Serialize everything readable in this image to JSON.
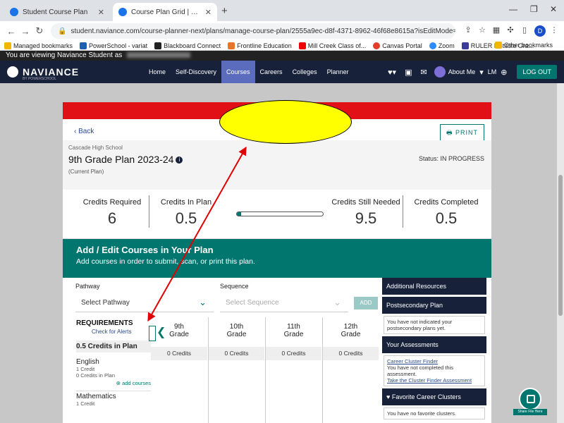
{
  "browser": {
    "tabs": [
      {
        "title": "Student Course Plan"
      },
      {
        "title": "Course Plan Grid | Manage Course..."
      }
    ],
    "url": "student.naviance.com/course-planner-next/plans/manage-course-plan/2555a9ec-d8f-4371-8962-46f68e8615a?isEditMode=true",
    "bookmarks": [
      "Managed bookmarks",
      "PowerSchool - variat",
      "Blackboard Connect",
      "Frontline Education",
      "Mill Creek Class of...",
      "Canvas Portal",
      "Zoom",
      "RULER Institute Gra..."
    ],
    "other_bookmarks": "Other bookmarks",
    "profile_initial": "D"
  },
  "viewing": {
    "text": "You are viewing Naviance Student as"
  },
  "nav": {
    "logo": "NAVIANCE",
    "logo_sub": "BY POWERSCHOOL",
    "links": [
      "Home",
      "Self-Discovery",
      "Courses",
      "Careers",
      "Colleges",
      "Planner"
    ],
    "about_me": "About Me",
    "initials": "LM",
    "logout": "LOG OUT"
  },
  "plan": {
    "back": "Back",
    "print": "PRINT",
    "school": "Cascade High School",
    "title": "9th Grade Plan 2023-24",
    "current": "(Current Plan)",
    "status": "Status: IN PROGRESS"
  },
  "credits": {
    "required_label": "Credits Required",
    "required_value": "6",
    "in_plan_label": "Credits In Plan",
    "in_plan_value": "0.5",
    "needed_label": "Credits Still Needed",
    "needed_value": "9.5",
    "completed_label": "Credits Completed",
    "completed_value": "0.5",
    "progress_fraction": 0.05
  },
  "add_section": {
    "heading": "Add / Edit Courses in Your Plan",
    "subheading": "Add courses in order to submit, scan, or print this plan."
  },
  "filters": {
    "pathway_label": "Pathway",
    "pathway_value": "Select Pathway",
    "sequence_label": "Sequence",
    "sequence_value": "Select Sequence",
    "add": "ADD"
  },
  "requirements": {
    "title": "REQUIREMENTS",
    "alerts": "Check for Alerts",
    "in_plan": "0.5 Credits in Plan",
    "subjects": [
      {
        "name": "English",
        "credit": "1 Credit",
        "in_plan": "0 Credits in Plan",
        "add": "add courses"
      },
      {
        "name": "Mathematics",
        "credit": "1 Credit"
      }
    ]
  },
  "grades": [
    {
      "num": "9th",
      "label": "Grade",
      "credits": "0 Credits"
    },
    {
      "num": "10th",
      "label": "Grade",
      "credits": "0 Credits"
    },
    {
      "num": "11th",
      "label": "Grade",
      "credits": "0 Credits"
    },
    {
      "num": "12th",
      "label": "Grade",
      "credits": "0 Credits"
    }
  ],
  "sidebar": {
    "resources": "Additional Resources",
    "postsec_title": "Postsecondary Plan",
    "postsec_body": "You have not indicated your postsecondary plans yet.",
    "assess_title": "Your Assessments",
    "cluster_name": "Career Cluster Finder",
    "cluster_body": "You have not completed this assessment.",
    "cluster_link": "Take the Cluster Finder Assessment",
    "fav_title": "Favorite Career Clusters",
    "fav_body": "You have no favorite clusters."
  },
  "fab": {
    "label": "Share File Here"
  },
  "colors": {
    "accent": "#00766f",
    "navy": "#17213a",
    "red": "#e10f16",
    "highlight": "#ffff00",
    "annotation": "#e00000"
  }
}
